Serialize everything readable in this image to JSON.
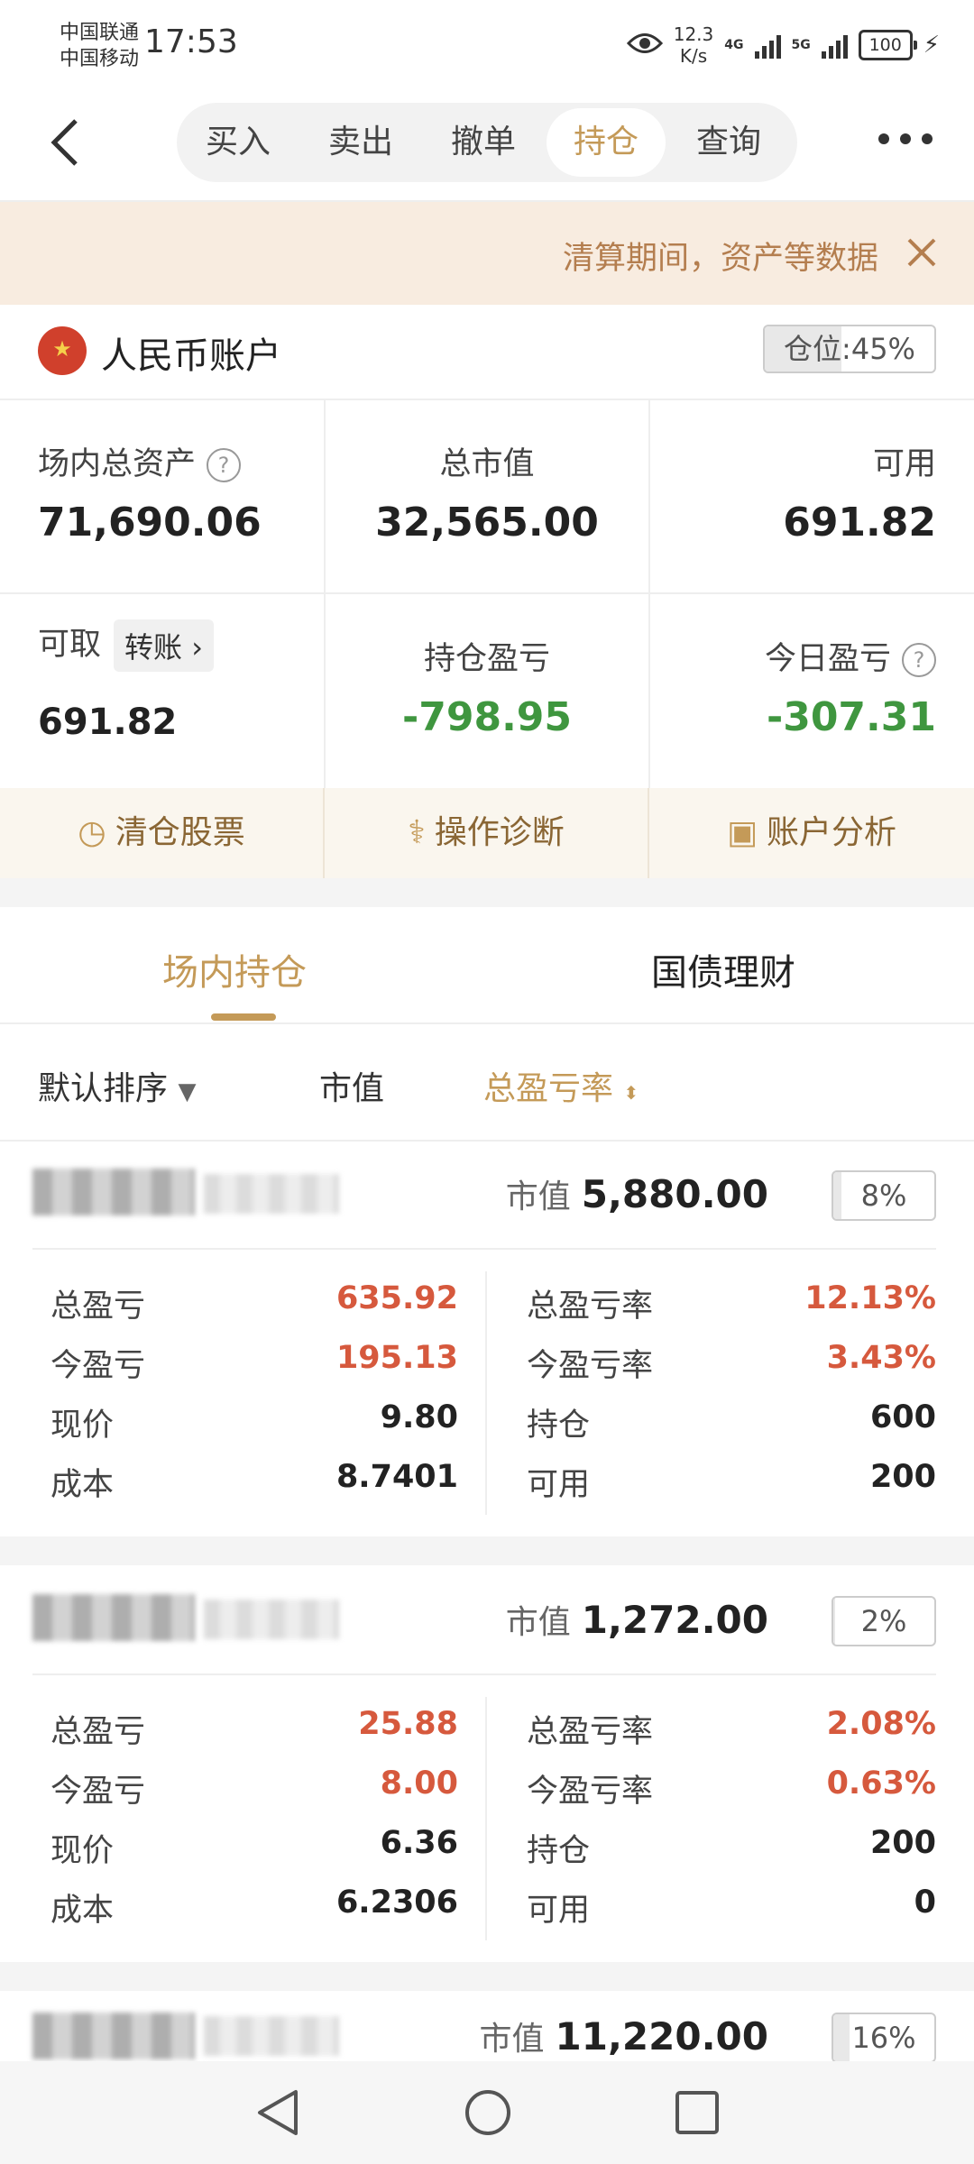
{
  "status": {
    "carrier1": "中国联通",
    "carrier2": "中国移动",
    "time": "17:53",
    "speed_value": "12.3",
    "speed_unit": "K/s",
    "net1": "4G",
    "net2": "5G",
    "battery": "100"
  },
  "nav": {
    "tabs": [
      "买入",
      "卖出",
      "撤单",
      "持仓",
      "查询"
    ],
    "active_tab": "持仓"
  },
  "notice": {
    "text": "清算期间，资产等数据"
  },
  "account": {
    "title": "人民币账户",
    "position_label": "仓位",
    "position_value": "45%",
    "position_fraction": 0.45
  },
  "metrics": {
    "total_assets_label": "场内总资产",
    "total_assets": "71,690.06",
    "market_value_label": "总市值",
    "market_value": "32,565.00",
    "available_label": "可用",
    "available": "691.82",
    "withdrawable_label": "可取",
    "transfer_label": "转账",
    "withdrawable": "691.82",
    "holding_pl_label": "持仓盈亏",
    "holding_pl": "-798.95",
    "today_pl_label": "今日盈亏",
    "today_pl": "-307.31"
  },
  "tools": [
    "清仓股票",
    "操作诊断",
    "账户分析"
  ],
  "holding_tabs": [
    "场内持仓",
    "国债理财"
  ],
  "sort": {
    "default": "默认排序",
    "market_value": "市值",
    "total_pl_rate": "总盈亏率"
  },
  "labels": {
    "market_value": "市值",
    "total_pl": "总盈亏",
    "today_pl": "今盈亏",
    "price": "现价",
    "cost": "成本",
    "total_pl_rate": "总盈亏率",
    "today_pl_rate": "今盈亏率",
    "holding": "持仓",
    "available": "可用"
  },
  "holdings": [
    {
      "market_value": "5,880.00",
      "weight": "8%",
      "weight_fraction": 0.08,
      "total_pl": "635.92",
      "today_pl": "195.13",
      "price": "9.80",
      "cost": "8.7401",
      "total_pl_rate": "12.13%",
      "today_pl_rate": "3.43%",
      "holding": "600",
      "available": "200"
    },
    {
      "market_value": "1,272.00",
      "weight": "2%",
      "weight_fraction": 0.02,
      "total_pl": "25.88",
      "today_pl": "8.00",
      "price": "6.36",
      "cost": "6.2306",
      "total_pl_rate": "2.08%",
      "today_pl_rate": "0.63%",
      "holding": "200",
      "available": "0"
    },
    {
      "market_value": "11,220.00",
      "weight": "16%",
      "weight_fraction": 0.16
    }
  ],
  "colors": {
    "accent": "#c49a58",
    "gain": "#d6593d",
    "loss": "#3f963f"
  }
}
